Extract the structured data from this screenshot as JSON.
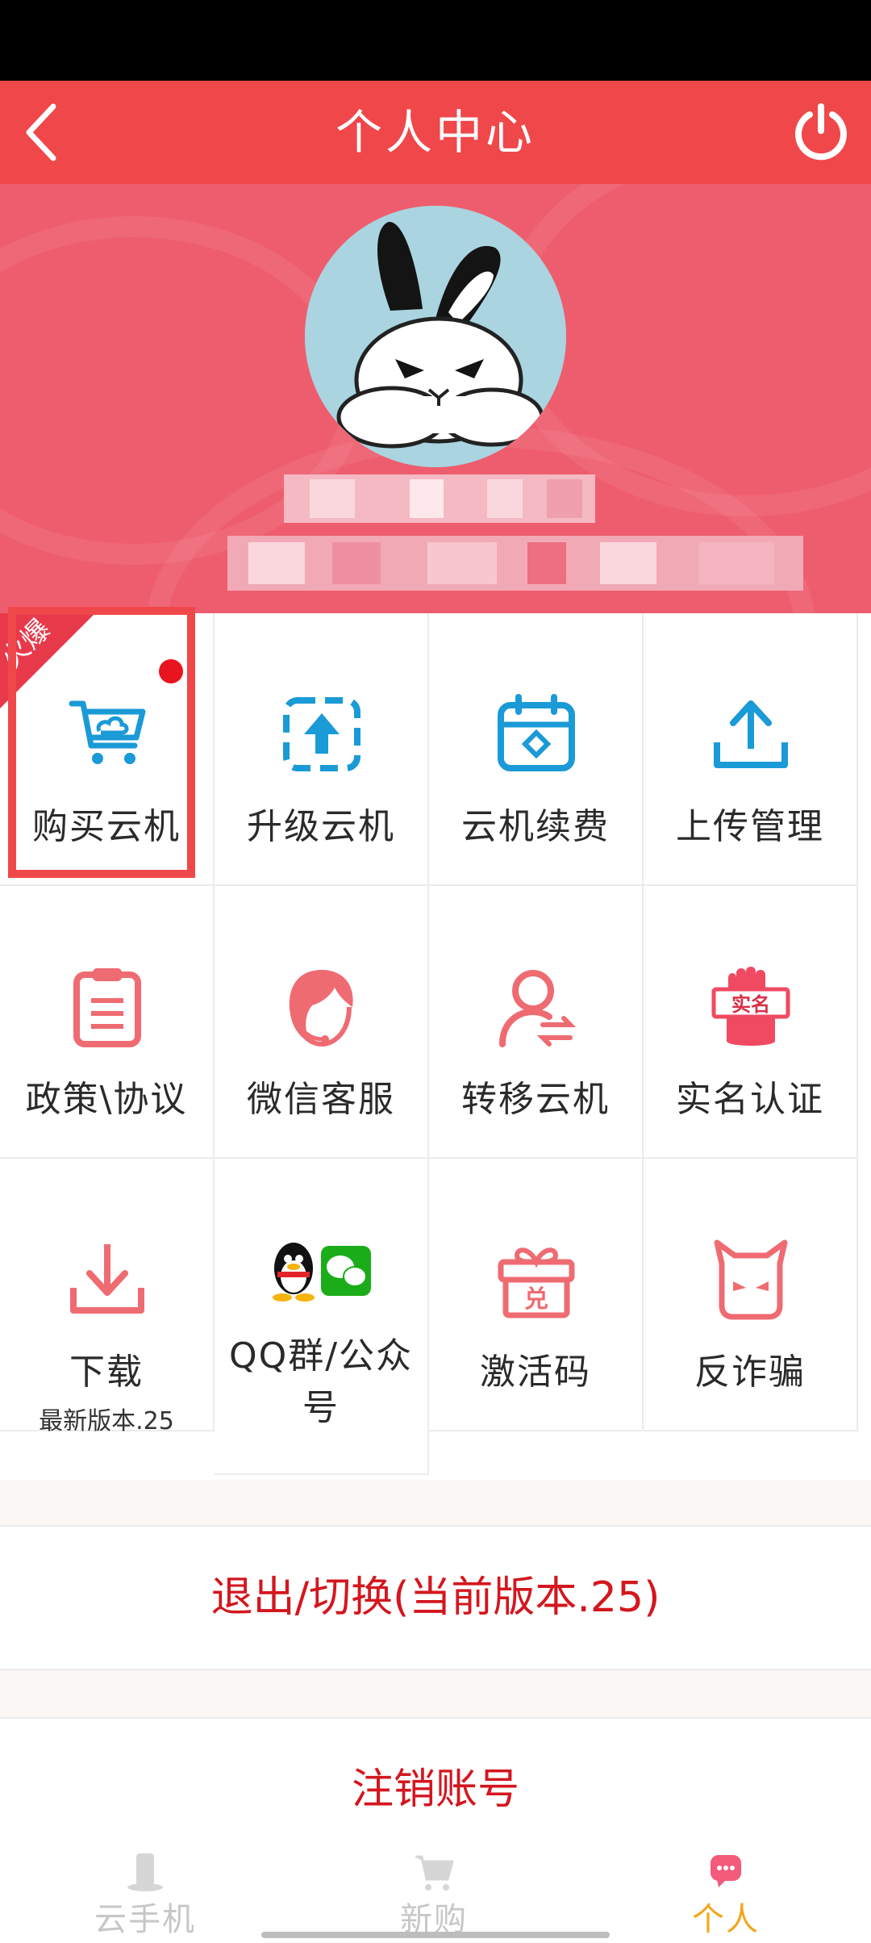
{
  "header": {
    "title": "个人中心",
    "back_icon": "chevron-left-icon",
    "power_icon": "power-icon"
  },
  "profile": {
    "avatar": "rabbit-avatar"
  },
  "hot_badge": {
    "label": "火爆"
  },
  "grid": [
    {
      "label": "购买云机",
      "icon": "cart-cloud-icon",
      "color": "#1a9ad6"
    },
    {
      "label": "升级云机",
      "icon": "upgrade-icon",
      "color": "#1a9ad6"
    },
    {
      "label": "云机续费",
      "icon": "renew-calendar-icon",
      "color": "#1a9ad6"
    },
    {
      "label": "上传管理",
      "icon": "upload-icon",
      "color": "#1a9ad6"
    },
    {
      "label": "政策\\协议",
      "icon": "clipboard-icon",
      "color": "#ef6b72"
    },
    {
      "label": "微信客服",
      "icon": "customer-service-icon",
      "color": "#ef6b72"
    },
    {
      "label": "转移云机",
      "icon": "transfer-user-icon",
      "color": "#ef6b72"
    },
    {
      "label": "实名认证",
      "icon": "realname-hand-icon",
      "color": "#ef6b72",
      "badge": "实名"
    },
    {
      "label": "下载",
      "sublabel": "最新版本.25",
      "icon": "download-icon",
      "color": "#ef6b72"
    },
    {
      "label": "QQ群/公众号",
      "label_line1": "QQ群/公众",
      "label_line2": "号",
      "icon": "qq-wechat-icon"
    },
    {
      "label": "激活码",
      "icon": "gift-icon",
      "color": "#ef6b72",
      "badge": "兑"
    },
    {
      "label": "反诈骗",
      "icon": "devil-icon",
      "color": "#ef6b72"
    }
  ],
  "actions": {
    "logout": "退出/切换(当前版本.25)",
    "delete_account": "注销账号"
  },
  "tabs": [
    {
      "label": "云手机",
      "icon": "phone-icon",
      "active": false
    },
    {
      "label": "新购",
      "icon": "cart-icon",
      "active": false
    },
    {
      "label": "个人",
      "icon": "chat-person-icon",
      "active": true
    }
  ],
  "colors": {
    "brand_red": "#f0474a",
    "accent_blue": "#1a9ad6",
    "accent_pink": "#ef6b72",
    "active_tab": "#f2a71e"
  }
}
